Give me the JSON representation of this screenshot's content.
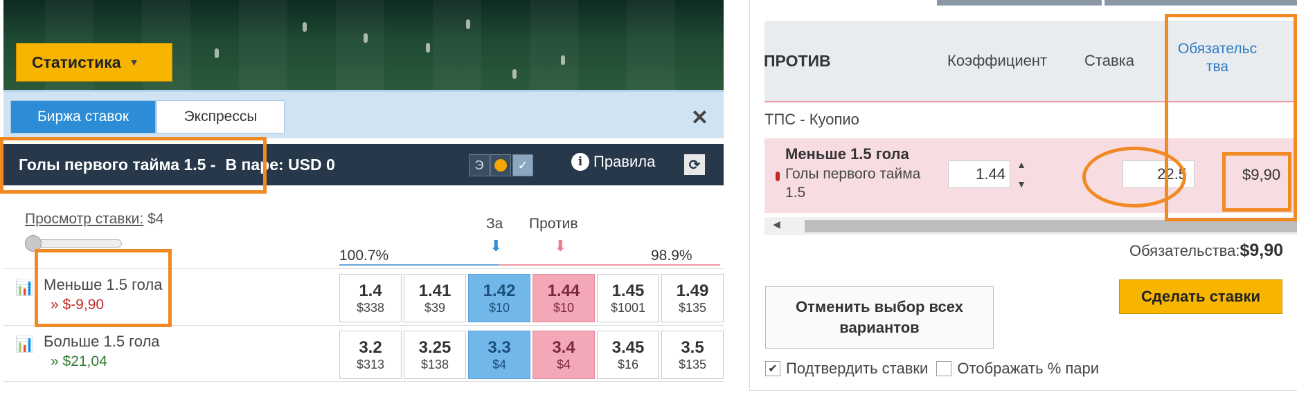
{
  "left": {
    "stats_button": "Статистика",
    "tabs": [
      {
        "label": "Биржа ставок"
      },
      {
        "label": "Экспрессы"
      }
    ],
    "close_label": "✕",
    "market": {
      "title": "Голы первого тайма 1.5 -",
      "pair": "В паре: USD 0",
      "btn_e": "Э",
      "rules": "Правила"
    },
    "preview": {
      "label": "Просмотр ставки:",
      "value": "$4"
    },
    "for_label": "За",
    "against_label": "Против",
    "book_pct_back": "100.7%",
    "book_pct_lay": "98.9%",
    "runners": [
      {
        "name": "Меньше 1.5 гола",
        "pl": "» $-9,90",
        "odds": [
          {
            "price": "1.4",
            "size": "$338"
          },
          {
            "price": "1.41",
            "size": "$39"
          },
          {
            "price": "1.42",
            "size": "$10"
          },
          {
            "price": "1.44",
            "size": "$10"
          },
          {
            "price": "1.45",
            "size": "$1001"
          },
          {
            "price": "1.49",
            "size": "$135"
          }
        ]
      },
      {
        "name": "Больше 1.5 гола",
        "pl": "» $21,04",
        "odds": [
          {
            "price": "3.2",
            "size": "$313"
          },
          {
            "price": "3.25",
            "size": "$138"
          },
          {
            "price": "3.3",
            "size": "$4"
          },
          {
            "price": "3.4",
            "size": "$4"
          },
          {
            "price": "3.45",
            "size": "$16"
          },
          {
            "price": "3.5",
            "size": "$135"
          }
        ]
      }
    ]
  },
  "right": {
    "columns": {
      "against": "ПРОТИВ",
      "coef": "Коэффициент",
      "stake": "Ставка",
      "liability": "Обязательс тва"
    },
    "event": "ТПС - Куопио",
    "bet": {
      "selection": "Меньше 1.5 гола",
      "market": "Голы первого тайма 1.5",
      "odds": "1.44",
      "stake": "22.5",
      "liability": "$9,90"
    },
    "total_label": "Обязательства:",
    "total_value": "$9,90",
    "cancel_button": "Отменить выбор всех вариантов",
    "place_button": "Сделать ставки",
    "confirm_label": "Подтвердить ставки",
    "show_pct_label": "Отображать % пари",
    "confirm_checked": true,
    "show_pct_checked": false
  },
  "colors": {
    "accent_yellow": "#f7b500",
    "back_blue": "#72b7ea",
    "lay_pink": "#f4a7b6",
    "header_dark": "#26384a",
    "annotation_orange": "#f28a24"
  }
}
